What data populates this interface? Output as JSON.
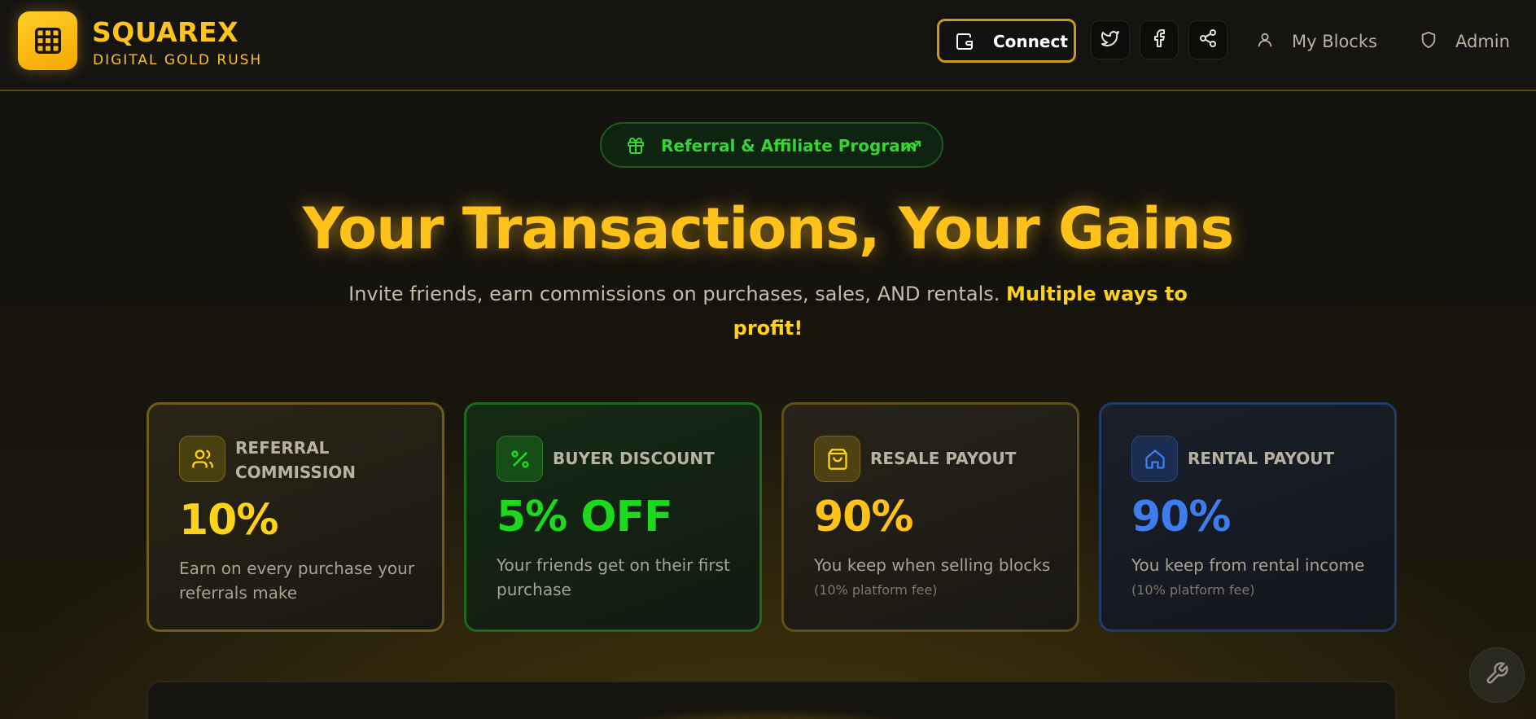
{
  "header": {
    "brand_name": "SQUAREX",
    "brand_tagline": "DIGITAL GOLD RUSH",
    "connect_label": "Connect",
    "nav": [
      {
        "label": "My Blocks",
        "icon": "user-icon"
      },
      {
        "label": "Admin",
        "icon": "shield-icon"
      }
    ],
    "social": [
      "twitter-icon",
      "facebook-icon",
      "share-icon"
    ]
  },
  "badge": {
    "label": "Referral & Affiliate Program",
    "icons": [
      "gift-icon",
      "trending-up-icon"
    ]
  },
  "hero": {
    "title": "Your Transactions, Your Gains",
    "subtitle": "Invite friends, earn commissions on purchases, sales, AND rentals.",
    "subtitle_highlight": "Multiple ways to profit!"
  },
  "cards": [
    {
      "label": "REFERRAL COMMISSION",
      "value": "10%",
      "desc": "Earn on every purchase your referrals make",
      "icon": "users-icon",
      "accent": "#ffd21a"
    },
    {
      "label": "BUYER DISCOUNT",
      "value": "5% OFF",
      "desc": "Your friends get on their first purchase",
      "icon": "percent-icon",
      "accent": "#1ed81e"
    },
    {
      "label": "RESALE PAYOUT",
      "value": "90%",
      "desc": "You keep when selling blocks",
      "note": "(10% platform fee)",
      "icon": "shopping-bag-icon",
      "accent": "#ffc21a"
    },
    {
      "label": "RENTAL PAYOUT",
      "value": "90%",
      "desc": "You keep from rental income",
      "note": "(10% platform fee)",
      "icon": "home-icon",
      "accent": "#3d7df0"
    }
  ],
  "fab_icon": "wrench-icon"
}
